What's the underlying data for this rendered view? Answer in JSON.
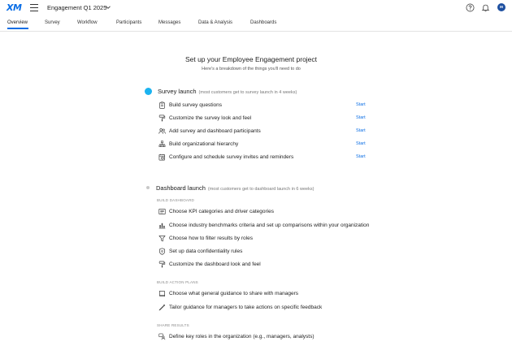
{
  "header": {
    "logo": "XM",
    "project_title": "Engagement Q1 2025"
  },
  "tabs": [
    {
      "label": "Overview",
      "active": true
    },
    {
      "label": "Survey"
    },
    {
      "label": "Workflow"
    },
    {
      "label": "Participants"
    },
    {
      "label": "Messages"
    },
    {
      "label": "Data & Analysis"
    },
    {
      "label": "Dashboards"
    }
  ],
  "main": {
    "heading": "Set up your Employee Engagement project",
    "subheading": "Here's a breakdown of the things you'll need to do"
  },
  "survey_launch": {
    "title": "Survey launch",
    "note": "(most customers get to survey launch in 4 weeks)",
    "items": [
      {
        "label": "Build survey questions",
        "action": "Start",
        "icon": "clipboard-icon"
      },
      {
        "label": "Customize the survey look and feel",
        "action": "Start",
        "icon": "paint-roller-icon"
      },
      {
        "label": "Add survey and dashboard participants",
        "action": "Start",
        "icon": "people-icon"
      },
      {
        "label": "Build organizational hierarchy",
        "action": "Start",
        "icon": "hierarchy-icon"
      },
      {
        "label": "Configure and schedule survey invites and reminders",
        "action": "Start",
        "icon": "calendar-gear-icon"
      }
    ]
  },
  "dashboard_launch": {
    "title": "Dashboard launch",
    "note": "(most customers get to dashboard launch in 6 weeks)",
    "groups": [
      {
        "label": "BUILD DASHBOARD",
        "items": [
          {
            "label": "Choose KPI categories and driver categories",
            "icon": "list-card-icon"
          },
          {
            "label": "Choose industry benchmarks criteria and set up comparisons within your organization",
            "icon": "bar-chart-icon"
          },
          {
            "label": "Choose how to filter results by roles",
            "icon": "filter-icon"
          },
          {
            "label": "Set up data confidentiality rules",
            "icon": "shield-icon"
          },
          {
            "label": "Customize the dashboard look and feel",
            "icon": "paint-roller-icon"
          }
        ]
      },
      {
        "label": "BUILD ACTION PLANS",
        "items": [
          {
            "label": "Choose what general guidance to share with managers",
            "icon": "book-icon"
          },
          {
            "label": "Tailor guidance for managers to take actions on specific feedback",
            "icon": "wrench-icon"
          }
        ]
      },
      {
        "label": "SHARE RESULTS",
        "items": [
          {
            "label": "Define key roles in the organization (e.g., managers, analysts)",
            "icon": "roles-icon"
          }
        ]
      }
    ]
  },
  "user": {
    "initials": "M"
  },
  "colors": {
    "accent": "#0b6ee5",
    "active_step": "#1bb3f0",
    "inactive_step": "#c8c8c8"
  }
}
